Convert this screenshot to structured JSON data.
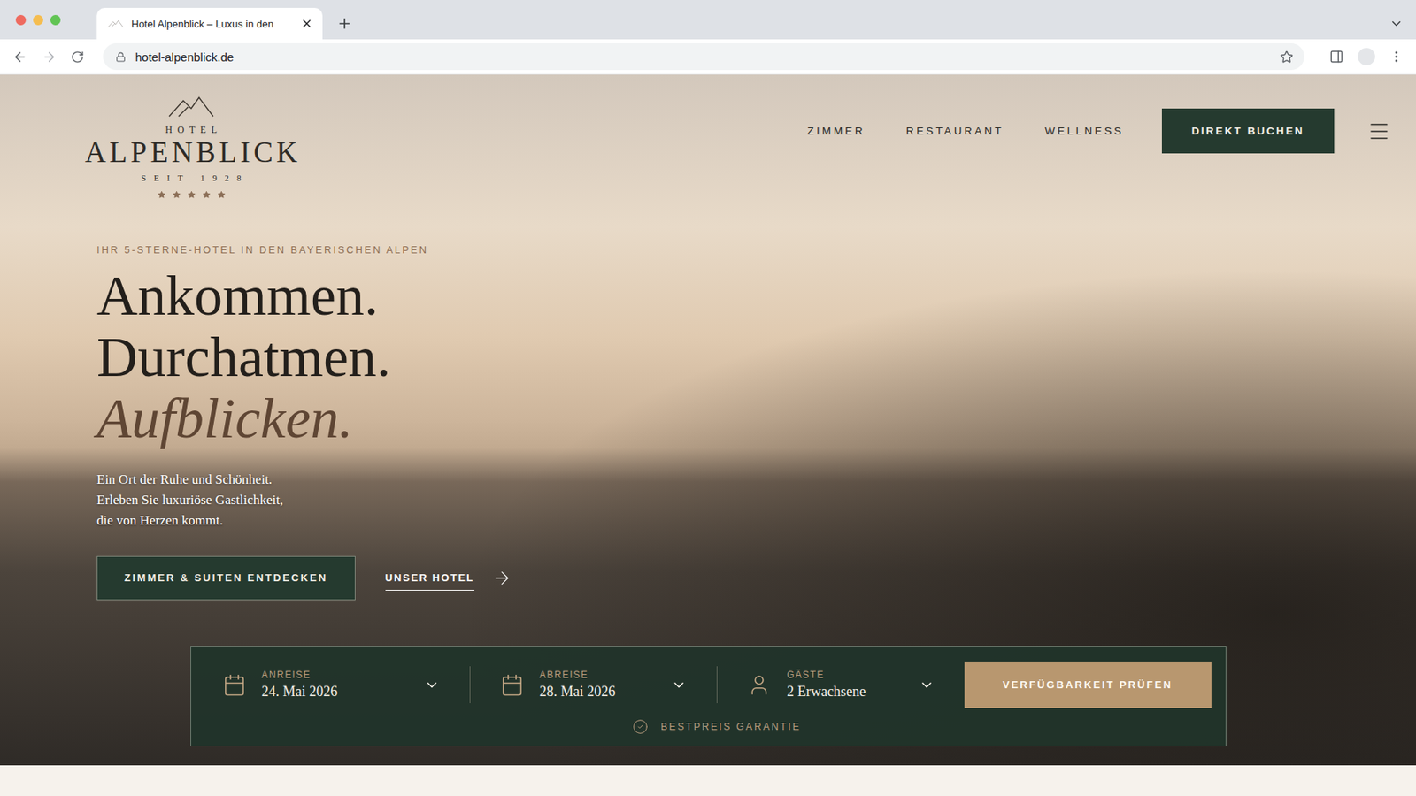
{
  "browser": {
    "tab_title": "Hotel Alpenblick – Luxus in den",
    "url": "hotel-alpenblick.de"
  },
  "logo": {
    "top": "HOTEL",
    "name": "ALPENBLICK",
    "since": "SEIT 1928",
    "stars": 5
  },
  "nav": {
    "links": [
      "ZIMMER",
      "RESTAURANT",
      "WELLNESS"
    ],
    "cta": "DIREKT BUCHEN"
  },
  "hero": {
    "eyebrow": "IHR 5-STERNE-HOTEL IN DEN BAYERISCHEN ALPEN",
    "headline": [
      {
        "text": "Ankommen.",
        "italic": false
      },
      {
        "text": "Durchatmen.",
        "italic": false
      },
      {
        "text": "Aufblicken.",
        "italic": true
      }
    ],
    "body": [
      "Ein Ort der Ruhe und Schönheit.",
      "Erleben Sie luxuriöse Gastlichkeit,",
      "die von Herzen kommt."
    ],
    "primary_button": "ZIMMER & SUITEN ENTDECKEN",
    "secondary_link": "UNSER HOTEL"
  },
  "booking": {
    "fields": [
      {
        "label": "ANREISE",
        "value": "24. Mai 2026",
        "kind": "date"
      },
      {
        "label": "ABREISE",
        "value": "28. Mai 2026",
        "kind": "date"
      },
      {
        "label": "GÄSTE",
        "value": "2 Erwachsene",
        "kind": "guests"
      }
    ],
    "button": "VERFÜGBARKEIT PRÜFEN",
    "guarantee": "BESTPREIS GARANTIE"
  }
}
